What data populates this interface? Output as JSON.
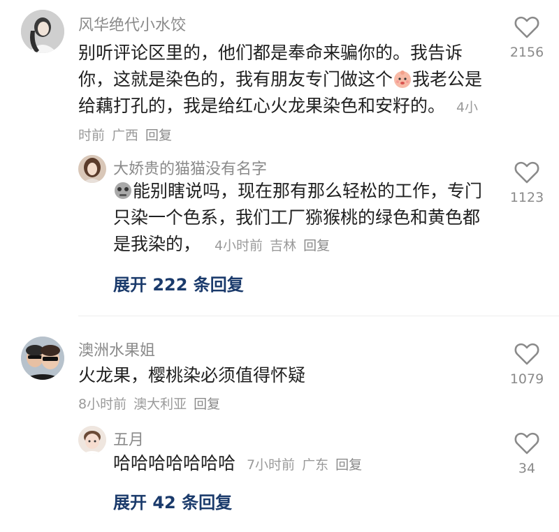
{
  "colors": {
    "name": "#8a8a8a",
    "text": "#1f1f1f",
    "meta": "#9a9a9a",
    "expand_link": "#1a3a6b",
    "divider": "#ededed"
  },
  "comments": [
    {
      "author": "风华绝代小水饺",
      "text_part1": "别听评论区里的，他们都是奉命来骗你的。我告诉你，这就是染色的，我有朋友专门做这个",
      "emoji": "baby-face-emoji",
      "text_part2": "我老公是给藕打孔的，我是给红心火龙果染色和安籽的。",
      "time": "4小时前",
      "location": "广西",
      "reply_label": "回复",
      "likes": "2156",
      "replies": [
        {
          "author": "大娇贵的猫猫没有名字",
          "emoji": "skull-face-emoji",
          "text": "能别瞎说吗，现在那有那么轻松的工作，专门只染一个色系，我们工厂猕猴桃的绿色和黄色都是我染的，",
          "time": "4小时前",
          "location": "吉林",
          "reply_label": "回复",
          "likes": "1123"
        }
      ],
      "expand_label": "展开 222 条回复"
    },
    {
      "author": "澳洲水果姐",
      "text": "火龙果，樱桃染必须值得怀疑",
      "time": "8小时前",
      "location": "澳大利亚",
      "reply_label": "回复",
      "likes": "1079",
      "replies": [
        {
          "author": "五月",
          "text": "哈哈哈哈哈哈哈",
          "time": "7小时前",
          "location": "广东",
          "reply_label": "回复",
          "likes": "34"
        }
      ],
      "expand_label": "展开 42 条回复"
    }
  ]
}
